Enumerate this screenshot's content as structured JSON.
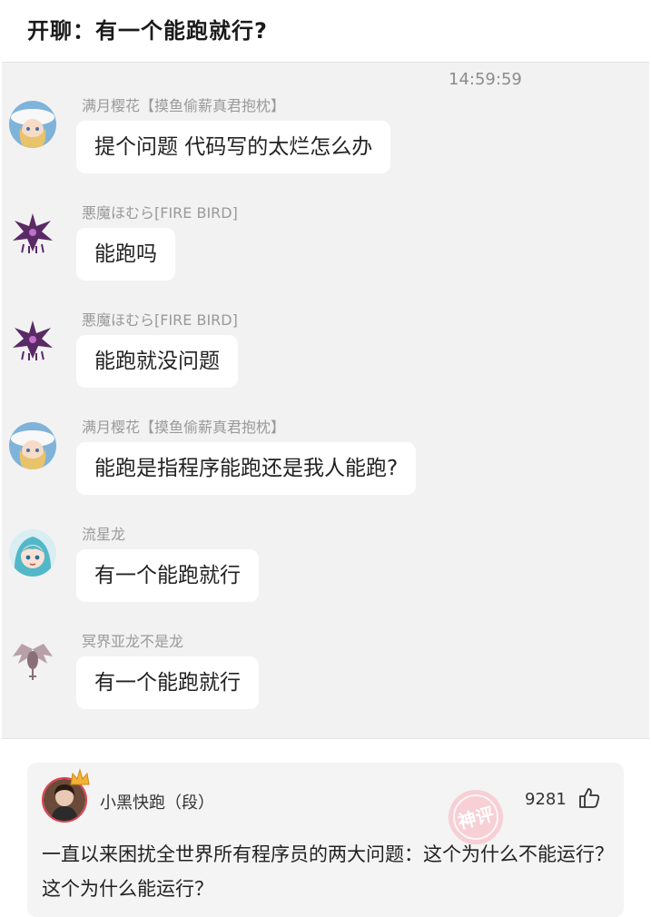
{
  "post": {
    "title": "开聊：有一个能跑就行?"
  },
  "chat": {
    "timestamp": "14:59:59",
    "messages": [
      {
        "sender": "满月樱花【摸鱼偷薪真君抱枕】",
        "text": "提个问题 代码写的太烂怎么办",
        "avatar": "anime-girl-white-hat-avatar"
      },
      {
        "sender": "悪魔ほむら[FIRE BIRD]",
        "text": "能跑吗",
        "avatar": "dark-wing-avatar"
      },
      {
        "sender": "悪魔ほむら[FIRE BIRD]",
        "text": "能跑就没问题",
        "avatar": "dark-wing-avatar"
      },
      {
        "sender": "满月樱花【摸鱼偷薪真君抱枕】",
        "text": "能跑是指程序能跑还是我人能跑?",
        "avatar": "anime-girl-white-hat-avatar"
      },
      {
        "sender": "流星龙",
        "text": "有一个能跑就行",
        "avatar": "anime-girl-teal-hair-avatar"
      },
      {
        "sender": "冥界亚龙不是龙",
        "text": "有一个能跑就行",
        "avatar": "winged-creature-avatar"
      }
    ]
  },
  "comment": {
    "username": "小黑快跑（段）",
    "likes": "9281",
    "badge": "神评",
    "text": "一直以来困扰全世界所有程序员的两大问题：这个为什么不能运行？这个为什么能运行？"
  }
}
